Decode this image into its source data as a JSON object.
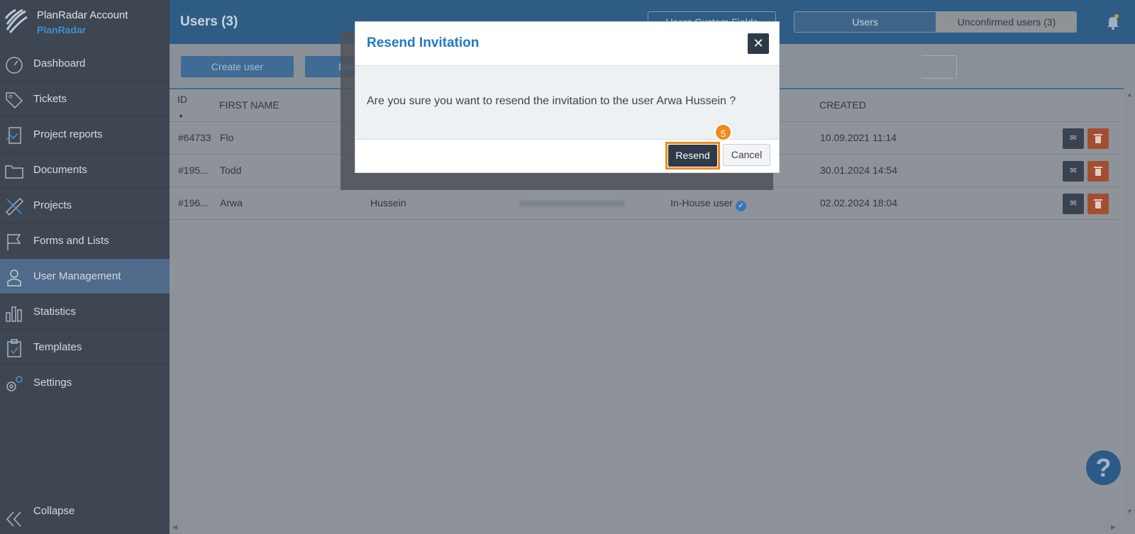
{
  "brand": {
    "title": "PlanRadar Account",
    "subtitle": "PlanRadar"
  },
  "sidebar": {
    "items": [
      {
        "label": "Dashboard",
        "icon": "dashboard-icon"
      },
      {
        "label": "Tickets",
        "icon": "tag-icon"
      },
      {
        "label": "Project reports",
        "icon": "report-icon"
      },
      {
        "label": "Documents",
        "icon": "folder-icon"
      },
      {
        "label": "Projects",
        "icon": "ruler-pencil-icon"
      },
      {
        "label": "Forms and Lists",
        "icon": "flag-icon"
      },
      {
        "label": "User Management",
        "icon": "user-icon",
        "active": true
      },
      {
        "label": "Statistics",
        "icon": "bar-chart-icon"
      },
      {
        "label": "Templates",
        "icon": "clipboard-icon"
      },
      {
        "label": "Settings",
        "icon": "gear-icon"
      }
    ],
    "collapse_label": "Collapse"
  },
  "header": {
    "title": "Users (3)",
    "custom_fields_label": "Users Custom Fields",
    "tabs": [
      {
        "label": "Users"
      },
      {
        "label": "Unconfirmed users (3)"
      }
    ]
  },
  "toolbar": {
    "create_label": "Create user",
    "invite_label": "Invi"
  },
  "table": {
    "columns": {
      "id": "ID",
      "first_name": "FIRST NAME",
      "created": "CREATED"
    },
    "rows": [
      {
        "id": "#64733",
        "first_name": "Flo",
        "created": "10.09.2021 11:14"
      },
      {
        "id": "#195...",
        "first_name": "Todd",
        "created": "30.01.2024 14:54"
      },
      {
        "id": "#196...",
        "first_name": "Arwa",
        "last_name": "Hussein",
        "role": "In-House user",
        "created": "02.02.2024 18:04"
      }
    ]
  },
  "modal": {
    "title": "Resend Invitation",
    "close_label": "✕",
    "message": "Are you sure you want to resend the invitation to the user Arwa Hussein ?",
    "resend_label": "Resend",
    "cancel_label": "Cancel",
    "step_badge": "5"
  },
  "help_label": "?",
  "colors": {
    "accent": "#1f7ac0",
    "highlight": "#f08a1c",
    "sidebar": "#3e4651",
    "header": "#2f5c85"
  }
}
